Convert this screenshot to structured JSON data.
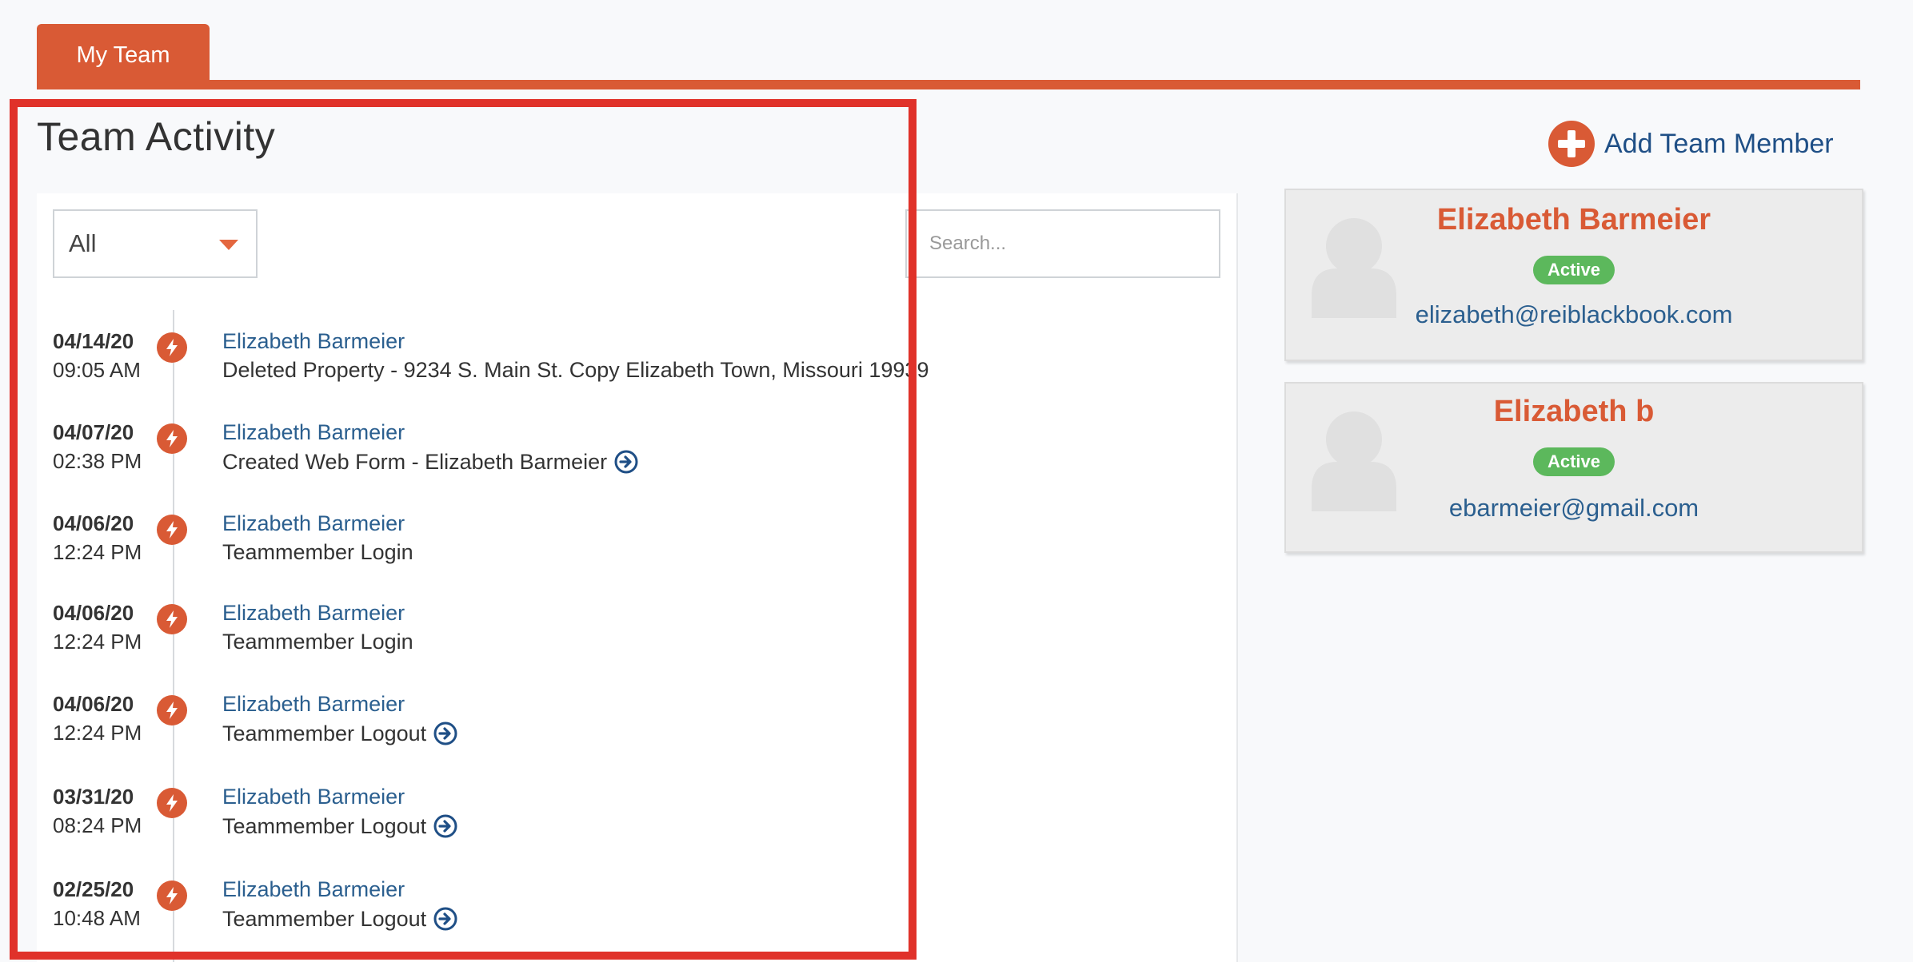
{
  "tab": {
    "label": "My Team"
  },
  "activity": {
    "title": "Team Activity",
    "filter_value": "All",
    "search_placeholder": "Search...",
    "entries": [
      {
        "date": "04/14/20",
        "time": "09:05 AM",
        "user": "Elizabeth Barmeier",
        "action": "Deleted Property - 9234 S. Main St. Copy Elizabeth Town, Missouri 19939",
        "has_link": false
      },
      {
        "date": "04/07/20",
        "time": "02:38 PM",
        "user": "Elizabeth Barmeier",
        "action": "Created Web Form - Elizabeth Barmeier",
        "has_link": true
      },
      {
        "date": "04/06/20",
        "time": "12:24 PM",
        "user": "Elizabeth Barmeier",
        "action": "Teammember Login",
        "has_link": false
      },
      {
        "date": "04/06/20",
        "time": "12:24 PM",
        "user": "Elizabeth Barmeier",
        "action": "Teammember Login",
        "has_link": false
      },
      {
        "date": "04/06/20",
        "time": "12:24 PM",
        "user": "Elizabeth Barmeier",
        "action": "Teammember Logout",
        "has_link": true
      },
      {
        "date": "03/31/20",
        "time": "08:24 PM",
        "user": "Elizabeth Barmeier",
        "action": "Teammember Logout",
        "has_link": true
      },
      {
        "date": "02/25/20",
        "time": "10:48 AM",
        "user": "Elizabeth Barmeier",
        "action": "Teammember Logout",
        "has_link": true
      }
    ]
  },
  "add_member": {
    "label": "Add Team Member"
  },
  "members": [
    {
      "name": "Elizabeth Barmeier",
      "status": "Active",
      "email": "elizabeth@reiblackbook.com"
    },
    {
      "name": "Elizabeth b",
      "status": "Active",
      "email": "ebarmeier@gmail.com"
    }
  ],
  "colors": {
    "brand": "#d95a35",
    "link": "#2b5f8f",
    "active": "#5cb85c",
    "highlight": "#e0322a"
  },
  "icons": {
    "entry": "lightning-icon",
    "link": "arrow-circle-right-icon",
    "add": "plus-circle-icon",
    "avatar": "user-silhouette-icon"
  }
}
